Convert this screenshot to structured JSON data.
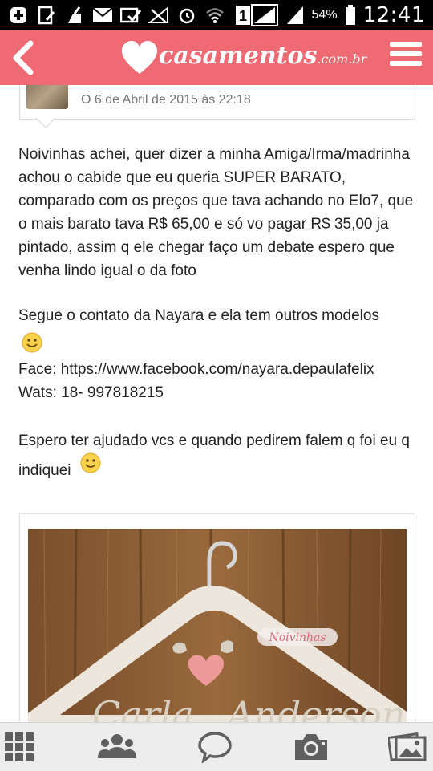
{
  "status_bar": {
    "battery_percent": "54%",
    "time": "12:41",
    "notification_badge": "1",
    "icons_left": [
      "add-icon",
      "note-icon",
      "cleaner-icon",
      "mail-icon",
      "mail-check-icon",
      "no-signal-icon",
      "alarm-icon",
      "wifi-icon",
      "sim-icon"
    ],
    "icons_right": [
      "signal-icon",
      "signal-icon",
      "battery-icon"
    ]
  },
  "app_bar": {
    "logo_text": "casamentos",
    "logo_suffix": ".com.br",
    "back_icon": "chevron-left-icon",
    "menu_icon": "hamburger-icon",
    "color": "#f06a73"
  },
  "reply": {
    "date": "O 6 de Abril de 2015 às 22:18"
  },
  "post": {
    "paragraph1": "Noivinhas achei, quer dizer a minha Amiga/Irma/madrinha achou o cabide que eu queria SUPER BARATO, comparado com os preços que tava achando no Elo7, que o mais barato tava R$ 65,00 e só vo pagar R$ 35,00 ja pintado, assim q ele chegar faço um debate espero que venha lindo igual o da foto",
    "paragraph2": "Segue o contato da Nayara e ela tem outros modelos",
    "face_line": "Face: https://www.facebook.com/nayara.depaulafelix",
    "wats_line": "Wats: 18- 997818215",
    "paragraph3": "Espero ter ajudado vcs e quando pedirem falem q foi eu q indiquei"
  },
  "photo": {
    "watermark": "Noivinhas",
    "hanger_text_left": "Carla",
    "hanger_text_right": "Anderson"
  },
  "bottom_nav": {
    "items": [
      "grid-icon",
      "community-icon",
      "chat-icon",
      "camera-icon",
      "gallery-icon"
    ]
  }
}
